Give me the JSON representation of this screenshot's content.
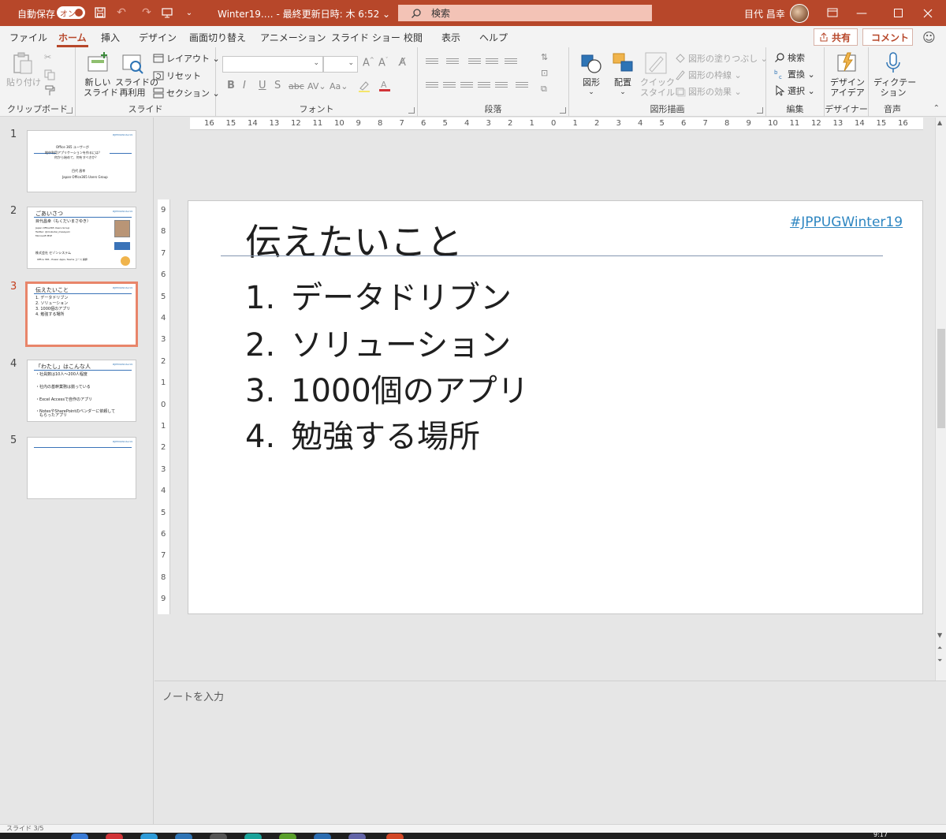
{
  "titlebar": {
    "autosave_label": "自動保存",
    "autosave_toggle": "オン",
    "doc_title": "Winter19.…  -  最終更新日時: 木 6:52 ⌄",
    "search_placeholder": "検索",
    "user_name": "目代 昌幸",
    "accent_color": "#b7472a"
  },
  "tabs": [
    "ファイル",
    "ホーム",
    "挿入",
    "デザイン",
    "画面切り替え",
    "アニメーション",
    "スライド ショー",
    "校閲",
    "表示",
    "ヘルプ"
  ],
  "active_tab": "ホーム",
  "share_label": "共有",
  "comment_label": "コメント",
  "ribbon": {
    "clipboard": {
      "label": "クリップボード",
      "paste": "貼り付け"
    },
    "slides": {
      "label": "スライド",
      "new_slide_1": "新しい",
      "new_slide_2": "スライド",
      "reuse_1": "スライドの",
      "reuse_2": "再利用",
      "layout": "レイアウト",
      "reset": "リセット",
      "section": "セクション"
    },
    "font": {
      "label": "フォント"
    },
    "paragraph": {
      "label": "段落"
    },
    "drawing": {
      "label": "図形描画",
      "shape": "図形",
      "arrange": "配置",
      "quick_1": "クイック",
      "quick_2": "スタイル",
      "fill": "図形の塗りつぶし",
      "outline": "図形の枠線",
      "effect": "図形の効果"
    },
    "editing": {
      "label": "編集",
      "find": "検索",
      "replace": "置換",
      "select": "選択"
    },
    "designer": {
      "label": "デザイナー",
      "ideas_1": "デザイン",
      "ideas_2": "アイデア"
    },
    "voice": {
      "label": "音声",
      "dictate_1": "ディクテー",
      "dictate_2": "ション"
    }
  },
  "ruler_labels": {
    "horizontal": [
      "16",
      "15",
      "14",
      "13",
      "12",
      "11",
      "10",
      "9",
      "8",
      "7",
      "6",
      "5",
      "4",
      "3",
      "2",
      "1",
      "0",
      "1",
      "2",
      "3",
      "4",
      "5",
      "6",
      "7",
      "8",
      "9",
      "10",
      "11",
      "12",
      "13",
      "14",
      "15",
      "16"
    ],
    "vertical": [
      "9",
      "8",
      "7",
      "6",
      "5",
      "4",
      "3",
      "2",
      "1",
      "0",
      "1",
      "2",
      "3",
      "4",
      "5",
      "6",
      "7",
      "8",
      "9"
    ]
  },
  "thumbnails": [
    {
      "num": "1",
      "lines": [
        "Office 365 ユーザーが",
        "地中利用アプリケーションを作るには？",
        "何から始めて、何をすべきか？",
        "目代 昌幸",
        "Japan Office365 Users Group"
      ]
    },
    {
      "num": "2",
      "title": "ごあいさつ",
      "lines": [
        "目代昌幸（もくだいまさゆき）",
        "Japan Office365 Users Group",
        "Twitter: @mokudai_masayuki",
        "Microsoft MVP",
        "株式会社 セゾンシステム",
        "Office 365 , Power Apps, Teams コース 講師"
      ]
    },
    {
      "num": "3",
      "title": "伝えたいこと",
      "lines": [
        "1. データドリブン",
        "2. ソリューション",
        "3. 1000個のアプリ",
        "4. 勉強する場所"
      ]
    },
    {
      "num": "4",
      "title": "「わたし」はこんな人",
      "lines": [
        "・社員数は10人～200人程度",
        "・社内の基幹業務は揃っている",
        "・Excel Accessで自作のアプリ",
        "・NotesやSharePointのベンダーに依頼して",
        "　もらったアプリ"
      ]
    },
    {
      "num": "5",
      "title": "",
      "lines": []
    }
  ],
  "thumb_tag": "#JPPUGWinter19",
  "slide": {
    "title": "伝えたいこと",
    "hashtag": "#JPPUGWinter19",
    "items": [
      {
        "num": "1.",
        "text": "データドリブン"
      },
      {
        "num": "2.",
        "text": "ソリューション"
      },
      {
        "num": "3.",
        "text": "1000個のアプリ"
      },
      {
        "num": "4.",
        "text": "勉強する場所"
      }
    ]
  },
  "notes_placeholder": "ノートを入力",
  "status": {
    "slide_info": "スライド 3/5"
  },
  "clock": "9:17"
}
